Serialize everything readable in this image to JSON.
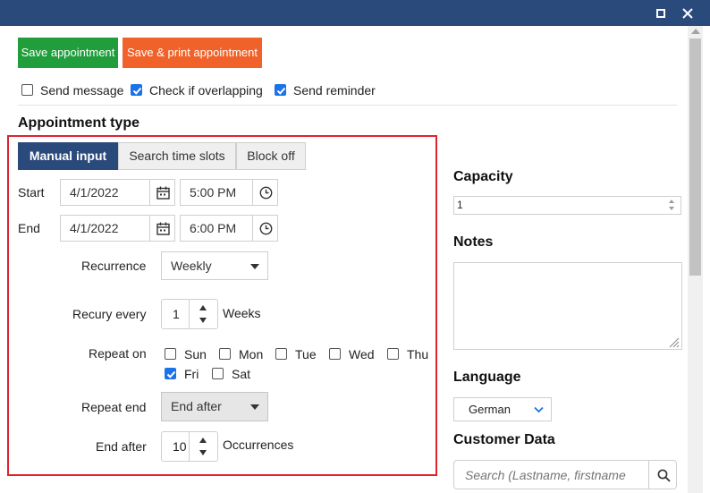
{
  "toolbar": {
    "save_label": "Save appointment",
    "save_print_label": "Save & print appointment"
  },
  "options": {
    "send_message": {
      "label": "Send message",
      "checked": false
    },
    "check_overlapping": {
      "label": "Check if overlapping",
      "checked": true
    },
    "send_reminder": {
      "label": "Send reminder",
      "checked": true
    }
  },
  "appointment_type": {
    "title": "Appointment type",
    "tabs": [
      "Manual input",
      "Search time slots",
      "Block off"
    ],
    "active_tab": "Manual input"
  },
  "start": {
    "label": "Start",
    "date": "4/1/2022",
    "time": "5:00 PM"
  },
  "end": {
    "label": "End",
    "date": "4/1/2022",
    "time": "6:00 PM"
  },
  "recurrence": {
    "label": "Recurrence",
    "value": "Weekly"
  },
  "recur_every": {
    "label": "Recury every",
    "value": "1",
    "unit": "Weeks"
  },
  "repeat_on": {
    "label": "Repeat on",
    "days": [
      {
        "label": "Sun",
        "checked": false
      },
      {
        "label": "Mon",
        "checked": false
      },
      {
        "label": "Tue",
        "checked": false
      },
      {
        "label": "Wed",
        "checked": false
      },
      {
        "label": "Thu",
        "checked": false
      },
      {
        "label": "Fri",
        "checked": true
      },
      {
        "label": "Sat",
        "checked": false
      }
    ]
  },
  "repeat_end": {
    "label": "Repeat end",
    "value": "End after"
  },
  "end_after": {
    "label": "End after",
    "value": "10",
    "unit": "Occurrences"
  },
  "capacity": {
    "title": "Capacity",
    "value": "1"
  },
  "notes": {
    "title": "Notes"
  },
  "language": {
    "title": "Language",
    "value": "German"
  },
  "customer_data": {
    "title": "Customer Data",
    "placeholder": "Search (Lastname, firstname"
  },
  "colors": {
    "titlebar": "#2b4a7c",
    "save_button": "#1f9e3b",
    "print_button": "#f0622a",
    "highlight_border": "#e0222e",
    "checkbox_accent": "#1a73e8"
  }
}
